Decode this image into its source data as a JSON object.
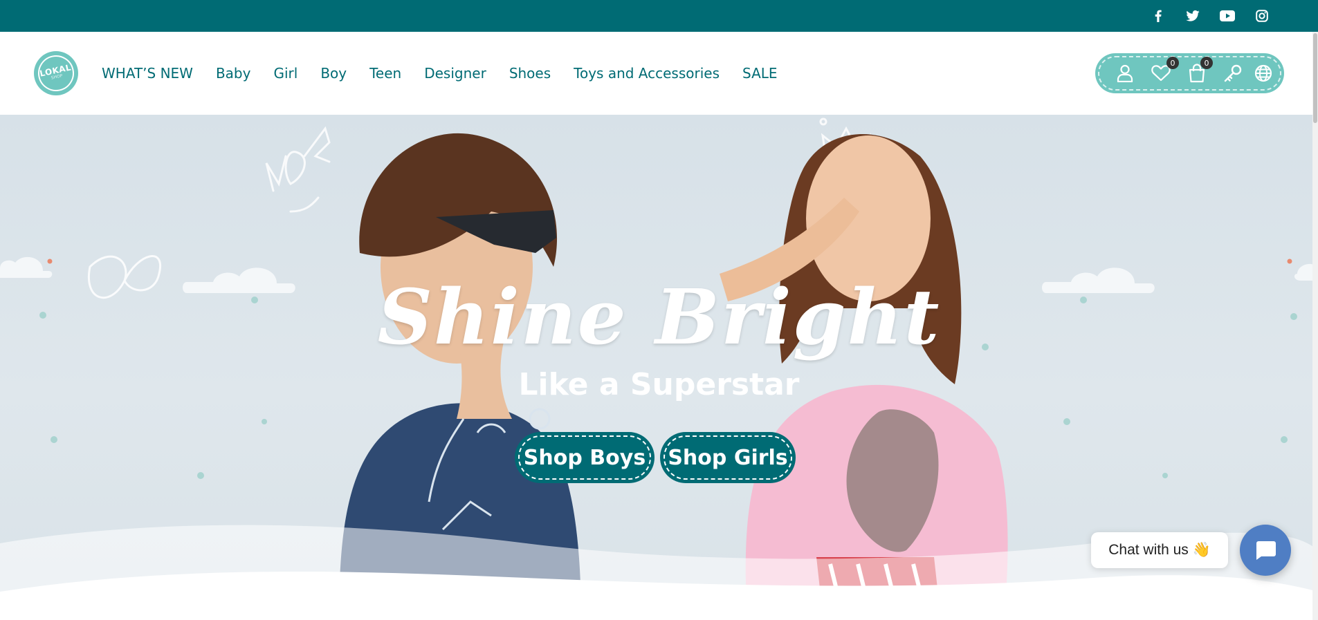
{
  "social": {
    "icons": [
      "facebook-icon",
      "twitter-icon",
      "youtube-icon",
      "instagram-icon"
    ]
  },
  "logo": {
    "main": "LOKAL",
    "sub": "SHOP"
  },
  "nav": {
    "items": [
      {
        "label": "WHAT’S NEW"
      },
      {
        "label": "Baby"
      },
      {
        "label": "Girl"
      },
      {
        "label": "Boy"
      },
      {
        "label": "Teen"
      },
      {
        "label": "Designer"
      },
      {
        "label": "Shoes"
      },
      {
        "label": "Toys and Accessories"
      },
      {
        "label": "SALE"
      }
    ]
  },
  "header_icons": {
    "wishlist_count": "0",
    "cart_count": "0",
    "icons": [
      "user-icon",
      "heart-icon",
      "shopping-bag-icon",
      "key-icon",
      "globe-icon"
    ]
  },
  "hero": {
    "headline": "Shine Bright",
    "subheadline": "Like a Superstar",
    "buttons": {
      "boys": "Shop Boys",
      "girls": "Shop Girls"
    }
  },
  "chat": {
    "label": "Chat with us 👋"
  },
  "colors": {
    "brand": "#006b74",
    "accent": "#6fc6bf",
    "chat": "#4f7ec4"
  }
}
